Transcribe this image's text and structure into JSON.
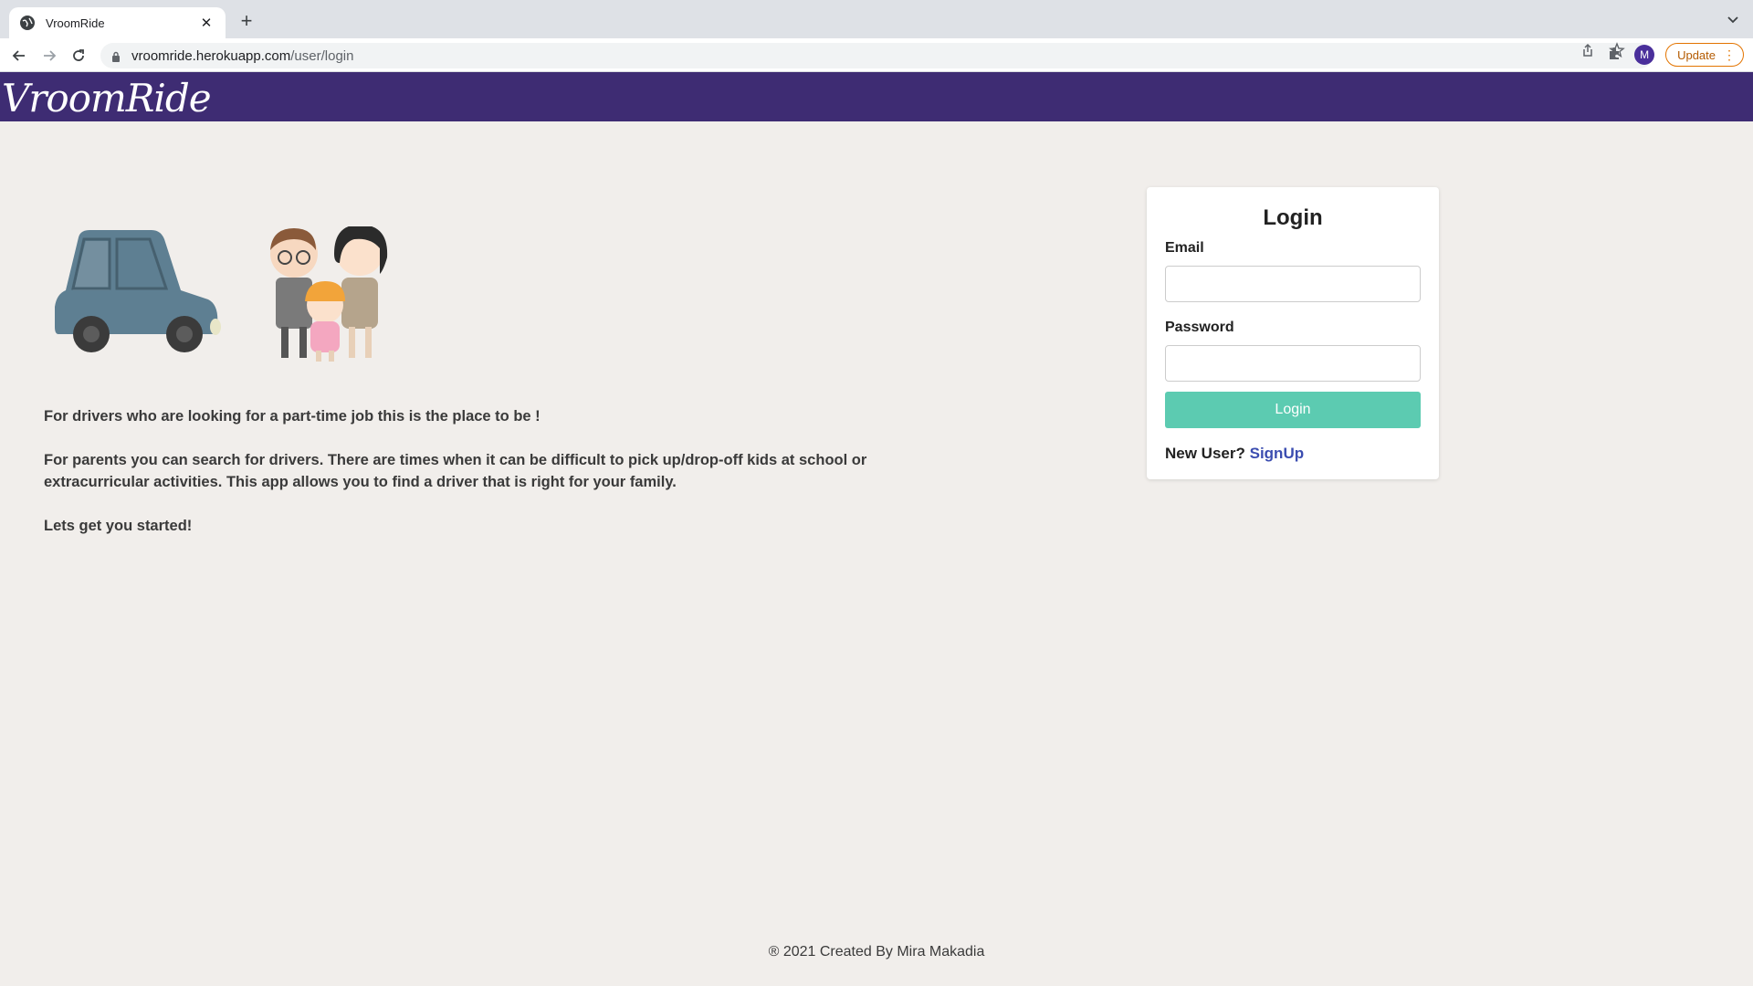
{
  "browser": {
    "tab_title": "VroomRide",
    "url_host": "vroomride.herokuapp.com",
    "url_path": "/user/login",
    "profile_initial": "M",
    "update_label": "Update"
  },
  "app": {
    "logo_text": "VroomRide",
    "brand_color": "#3e2c73"
  },
  "intro": {
    "line1": "For drivers who are looking for a part-time job this is the place to be !",
    "line2": "For parents you can search for drivers. There are times when it can be difficult to pick up/drop-off kids at school or extracurricular activities. This app allows you to find a driver that is right for your family.",
    "line3": "Lets get you started!"
  },
  "login": {
    "title": "Login",
    "email_label": "Email",
    "email_value": "",
    "password_label": "Password",
    "password_value": "",
    "button_label": "Login",
    "new_user_text": "New User?",
    "signup_link": "SignUp",
    "button_color": "#5ccbb1"
  },
  "footer": {
    "text": "® 2021 Created By Mira Makadia"
  }
}
